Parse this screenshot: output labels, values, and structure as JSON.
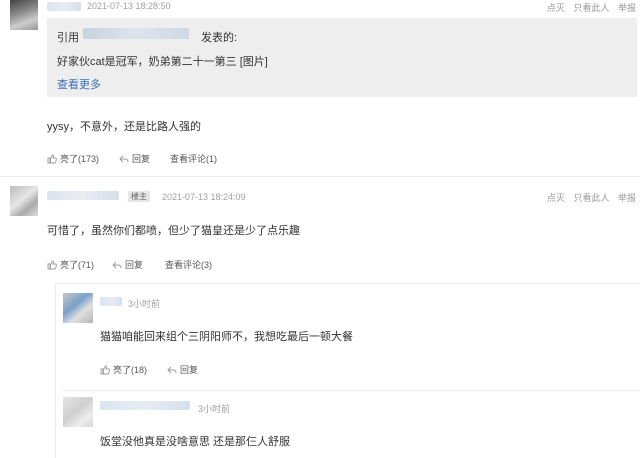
{
  "comment1": {
    "timestamp": "2021-07-13 18:28:50",
    "quote": {
      "prefix": "引用",
      "suffix": "发表的:",
      "body": "好家伙cat是冠军，奶弟第二十一第三 [图片]",
      "more": "查看更多"
    },
    "text": "yysy，不意外，还是比路人强的",
    "like": "亮了(173)",
    "reply": "回复",
    "view": "查看评论(1)",
    "actions": [
      "点灭",
      "只看此人",
      "举报"
    ]
  },
  "comment2": {
    "badge": "楼主",
    "timestamp": "2021-07-13 18:24:09",
    "text": "可惜了，虽然你们都喷，但少了猫皇还是少了点乐趣",
    "like": "亮了(71)",
    "reply": "回复",
    "view": "查看评论(3)",
    "actions": [
      "点灭",
      "只看此人",
      "举报"
    ]
  },
  "sub1": {
    "time": "3小时前",
    "text": "猫猫咱能回来组个三阴阳师不，我想吃最后一顿大餐",
    "like": "亮了(18)",
    "reply": "回复"
  },
  "sub2": {
    "time": "3小时前",
    "text": "饭堂没他真是没啥意思 还是那仨人舒服"
  },
  "icons": {
    "like": "thumbs-up-icon",
    "reply": "reply-arrow-icon"
  }
}
